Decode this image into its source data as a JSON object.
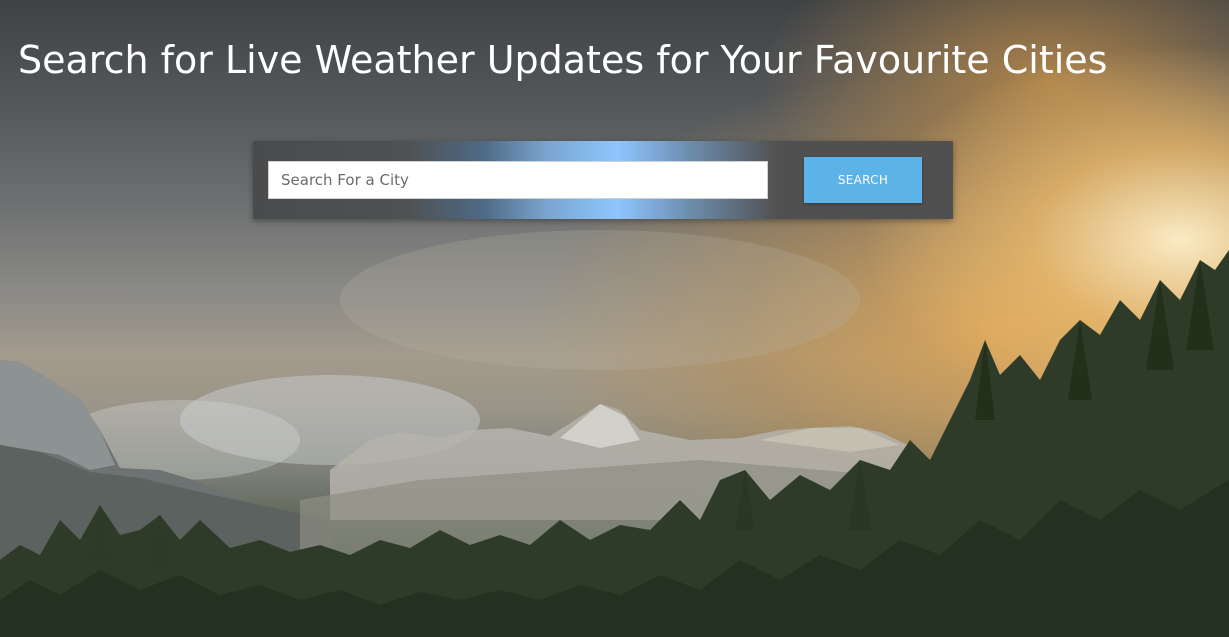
{
  "header": {
    "title": "Search for Live Weather Updates for Your Favourite Cities"
  },
  "search": {
    "placeholder": "Search For a City",
    "value": "",
    "button_label": "SEARCH"
  },
  "background": {
    "description_icon": "mountain-forest-sunset-image",
    "accent_button_color": "#5cb3e8",
    "panel_glow_color": "#8ec6ff"
  }
}
